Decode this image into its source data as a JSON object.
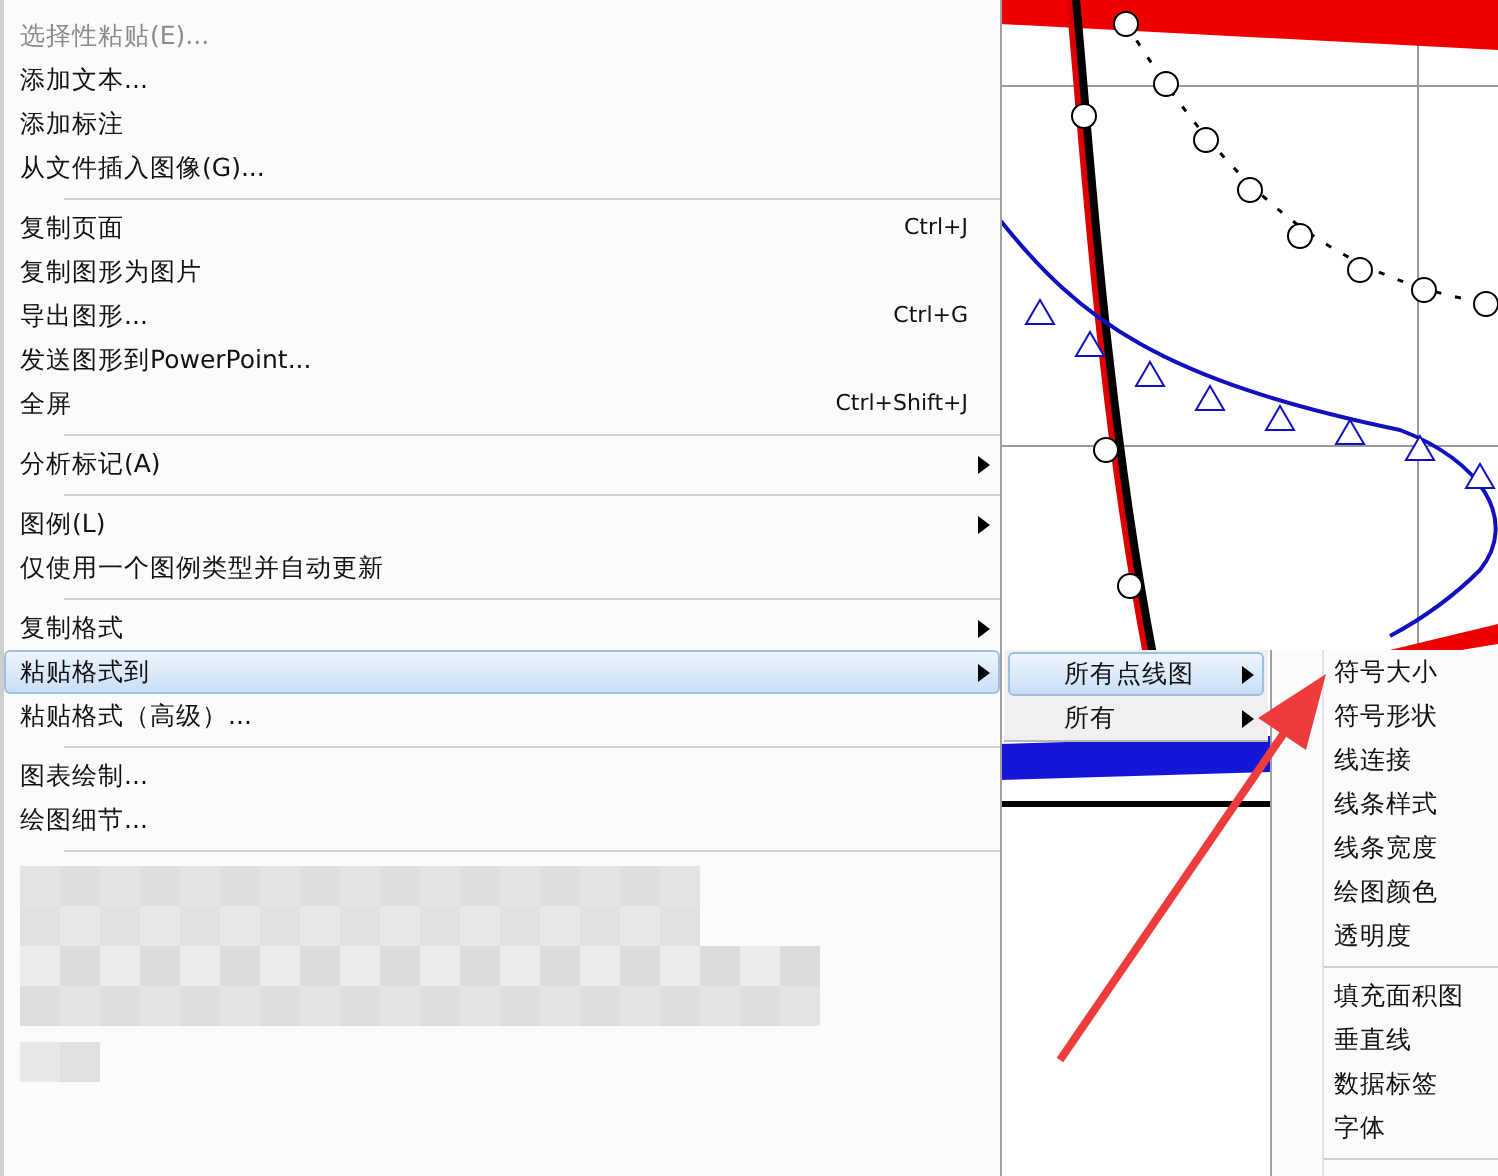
{
  "main_menu": {
    "items": [
      {
        "kind": "item",
        "label": "选择性粘贴(E)...",
        "disabled": true
      },
      {
        "kind": "item",
        "label": "添加文本...",
        "disabled": false
      },
      {
        "kind": "item",
        "label": "添加标注",
        "disabled": false
      },
      {
        "kind": "item",
        "label": "从文件插入图像(G)...",
        "disabled": false
      },
      {
        "kind": "separator"
      },
      {
        "kind": "item",
        "label": "复制页面",
        "shortcut": "Ctrl+J",
        "disabled": false
      },
      {
        "kind": "item",
        "label": "复制图形为图片",
        "disabled": false
      },
      {
        "kind": "item",
        "label": "导出图形...",
        "shortcut": "Ctrl+G",
        "disabled": false
      },
      {
        "kind": "item",
        "label": "发送图形到PowerPoint...",
        "disabled": false
      },
      {
        "kind": "item",
        "label": "全屏",
        "shortcut": "Ctrl+Shift+J",
        "disabled": false
      },
      {
        "kind": "separator"
      },
      {
        "kind": "item",
        "label": "分析标记(A)",
        "submenu": true,
        "disabled": false
      },
      {
        "kind": "separator"
      },
      {
        "kind": "item",
        "label": "图例(L)",
        "submenu": true,
        "disabled": false
      },
      {
        "kind": "item",
        "label": "仅使用一个图例类型并自动更新",
        "disabled": false
      },
      {
        "kind": "separator"
      },
      {
        "kind": "item",
        "label": "复制格式",
        "submenu": true,
        "disabled": false
      },
      {
        "kind": "item",
        "label": "粘贴格式到",
        "submenu": true,
        "selected": true,
        "disabled": false
      },
      {
        "kind": "item",
        "label": "粘贴格式（高级）...",
        "disabled": false
      },
      {
        "kind": "separator"
      },
      {
        "kind": "item",
        "label": "图表绘制...",
        "disabled": false
      },
      {
        "kind": "item",
        "label": "绘图细节...",
        "disabled": false
      },
      {
        "kind": "separator"
      }
    ]
  },
  "submenu_1": {
    "items": [
      {
        "kind": "item",
        "label": "所有点线图",
        "submenu": true,
        "selected": true
      },
      {
        "kind": "item",
        "label": "所有",
        "submenu": true,
        "selected": false
      }
    ]
  },
  "submenu_2": {
    "items": [
      {
        "kind": "item",
        "label": "符号大小"
      },
      {
        "kind": "item",
        "label": "符号形状"
      },
      {
        "kind": "item",
        "label": "线连接"
      },
      {
        "kind": "item",
        "label": "线条样式"
      },
      {
        "kind": "item",
        "label": "线条宽度"
      },
      {
        "kind": "item",
        "label": "绘图颜色"
      },
      {
        "kind": "item",
        "label": "透明度"
      },
      {
        "kind": "separator"
      },
      {
        "kind": "item",
        "label": "填充面积图"
      },
      {
        "kind": "item",
        "label": "垂直线"
      },
      {
        "kind": "item",
        "label": "数据标签"
      },
      {
        "kind": "item",
        "label": "字体"
      },
      {
        "kind": "separator"
      }
    ]
  }
}
